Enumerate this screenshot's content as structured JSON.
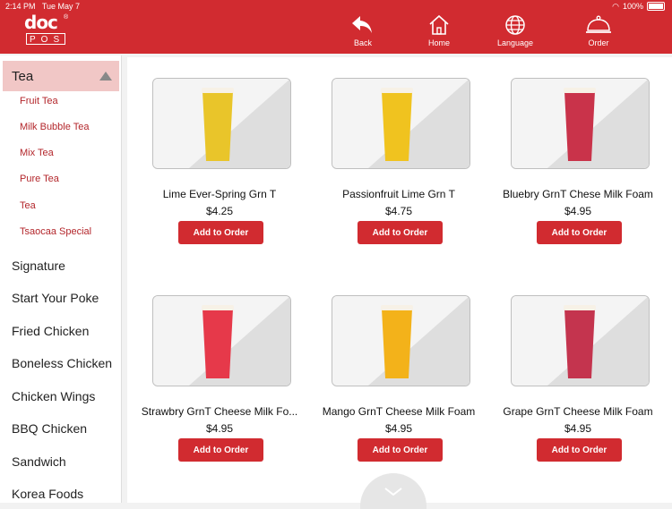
{
  "status": {
    "time": "2:14 PM",
    "date": "Tue May 7",
    "battery": "100%"
  },
  "logo": {
    "mark": "doc",
    "sub": "POS"
  },
  "nav": {
    "back": "Back",
    "home": "Home",
    "language": "Language",
    "order": "Order"
  },
  "sidebar": {
    "active": "Tea",
    "sub_items": [
      "Fruit Tea",
      "Milk Bubble Tea",
      "Mix Tea",
      "Pure Tea",
      "Tea",
      "Tsaocaa Special"
    ],
    "categories": [
      "Signature",
      "Start Your Poke",
      "Fried Chicken",
      "Boneless Chicken",
      "Chicken Wings",
      "BBQ Chicken",
      "Sandwich",
      "Korea Foods"
    ]
  },
  "products": [
    {
      "name": "Lime Ever-Spring Grn T",
      "price": "$4.25",
      "button": "Add to Order",
      "color": "#e9c52a"
    },
    {
      "name": "Passionfruit Lime Grn T",
      "price": "$4.75",
      "button": "Add to Order",
      "color": "#f0c31f"
    },
    {
      "name": "Bluebry GrnT Chese Milk Foam",
      "price": "$4.95",
      "button": "Add to Order",
      "color": "#c9334a"
    },
    {
      "name": "Strawbry GrnT Cheese Milk Fo...",
      "price": "$4.95",
      "button": "Add to Order",
      "color": "#e6394a"
    },
    {
      "name": "Mango GrnT Cheese Milk Foam",
      "price": "$4.95",
      "button": "Add to Order",
      "color": "#f3b21a"
    },
    {
      "name": "Grape GrnT Cheese Milk Foam",
      "price": "$4.95",
      "button": "Add to Order",
      "color": "#c4344e"
    }
  ]
}
